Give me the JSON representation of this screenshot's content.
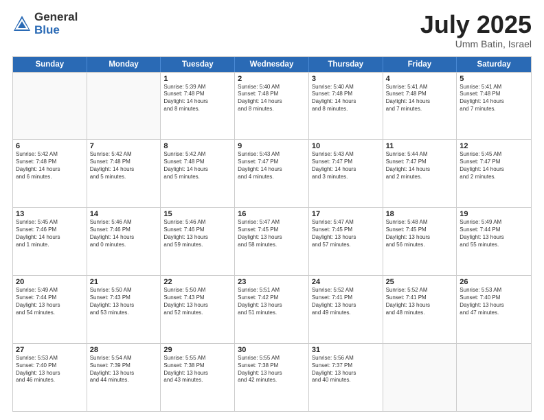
{
  "header": {
    "logo_general": "General",
    "logo_blue": "Blue",
    "month_title": "July 2025",
    "location": "Umm Batin, Israel"
  },
  "weekdays": [
    "Sunday",
    "Monday",
    "Tuesday",
    "Wednesday",
    "Thursday",
    "Friday",
    "Saturday"
  ],
  "rows": [
    [
      {
        "day": "",
        "info": ""
      },
      {
        "day": "",
        "info": ""
      },
      {
        "day": "1",
        "info": "Sunrise: 5:39 AM\nSunset: 7:48 PM\nDaylight: 14 hours\nand 8 minutes."
      },
      {
        "day": "2",
        "info": "Sunrise: 5:40 AM\nSunset: 7:48 PM\nDaylight: 14 hours\nand 8 minutes."
      },
      {
        "day": "3",
        "info": "Sunrise: 5:40 AM\nSunset: 7:48 PM\nDaylight: 14 hours\nand 8 minutes."
      },
      {
        "day": "4",
        "info": "Sunrise: 5:41 AM\nSunset: 7:48 PM\nDaylight: 14 hours\nand 7 minutes."
      },
      {
        "day": "5",
        "info": "Sunrise: 5:41 AM\nSunset: 7:48 PM\nDaylight: 14 hours\nand 7 minutes."
      }
    ],
    [
      {
        "day": "6",
        "info": "Sunrise: 5:42 AM\nSunset: 7:48 PM\nDaylight: 14 hours\nand 6 minutes."
      },
      {
        "day": "7",
        "info": "Sunrise: 5:42 AM\nSunset: 7:48 PM\nDaylight: 14 hours\nand 5 minutes."
      },
      {
        "day": "8",
        "info": "Sunrise: 5:42 AM\nSunset: 7:48 PM\nDaylight: 14 hours\nand 5 minutes."
      },
      {
        "day": "9",
        "info": "Sunrise: 5:43 AM\nSunset: 7:47 PM\nDaylight: 14 hours\nand 4 minutes."
      },
      {
        "day": "10",
        "info": "Sunrise: 5:43 AM\nSunset: 7:47 PM\nDaylight: 14 hours\nand 3 minutes."
      },
      {
        "day": "11",
        "info": "Sunrise: 5:44 AM\nSunset: 7:47 PM\nDaylight: 14 hours\nand 2 minutes."
      },
      {
        "day": "12",
        "info": "Sunrise: 5:45 AM\nSunset: 7:47 PM\nDaylight: 14 hours\nand 2 minutes."
      }
    ],
    [
      {
        "day": "13",
        "info": "Sunrise: 5:45 AM\nSunset: 7:46 PM\nDaylight: 14 hours\nand 1 minute."
      },
      {
        "day": "14",
        "info": "Sunrise: 5:46 AM\nSunset: 7:46 PM\nDaylight: 14 hours\nand 0 minutes."
      },
      {
        "day": "15",
        "info": "Sunrise: 5:46 AM\nSunset: 7:46 PM\nDaylight: 13 hours\nand 59 minutes."
      },
      {
        "day": "16",
        "info": "Sunrise: 5:47 AM\nSunset: 7:45 PM\nDaylight: 13 hours\nand 58 minutes."
      },
      {
        "day": "17",
        "info": "Sunrise: 5:47 AM\nSunset: 7:45 PM\nDaylight: 13 hours\nand 57 minutes."
      },
      {
        "day": "18",
        "info": "Sunrise: 5:48 AM\nSunset: 7:45 PM\nDaylight: 13 hours\nand 56 minutes."
      },
      {
        "day": "19",
        "info": "Sunrise: 5:49 AM\nSunset: 7:44 PM\nDaylight: 13 hours\nand 55 minutes."
      }
    ],
    [
      {
        "day": "20",
        "info": "Sunrise: 5:49 AM\nSunset: 7:44 PM\nDaylight: 13 hours\nand 54 minutes."
      },
      {
        "day": "21",
        "info": "Sunrise: 5:50 AM\nSunset: 7:43 PM\nDaylight: 13 hours\nand 53 minutes."
      },
      {
        "day": "22",
        "info": "Sunrise: 5:50 AM\nSunset: 7:43 PM\nDaylight: 13 hours\nand 52 minutes."
      },
      {
        "day": "23",
        "info": "Sunrise: 5:51 AM\nSunset: 7:42 PM\nDaylight: 13 hours\nand 51 minutes."
      },
      {
        "day": "24",
        "info": "Sunrise: 5:52 AM\nSunset: 7:41 PM\nDaylight: 13 hours\nand 49 minutes."
      },
      {
        "day": "25",
        "info": "Sunrise: 5:52 AM\nSunset: 7:41 PM\nDaylight: 13 hours\nand 48 minutes."
      },
      {
        "day": "26",
        "info": "Sunrise: 5:53 AM\nSunset: 7:40 PM\nDaylight: 13 hours\nand 47 minutes."
      }
    ],
    [
      {
        "day": "27",
        "info": "Sunrise: 5:53 AM\nSunset: 7:40 PM\nDaylight: 13 hours\nand 46 minutes."
      },
      {
        "day": "28",
        "info": "Sunrise: 5:54 AM\nSunset: 7:39 PM\nDaylight: 13 hours\nand 44 minutes."
      },
      {
        "day": "29",
        "info": "Sunrise: 5:55 AM\nSunset: 7:38 PM\nDaylight: 13 hours\nand 43 minutes."
      },
      {
        "day": "30",
        "info": "Sunrise: 5:55 AM\nSunset: 7:38 PM\nDaylight: 13 hours\nand 42 minutes."
      },
      {
        "day": "31",
        "info": "Sunrise: 5:56 AM\nSunset: 7:37 PM\nDaylight: 13 hours\nand 40 minutes."
      },
      {
        "day": "",
        "info": ""
      },
      {
        "day": "",
        "info": ""
      }
    ]
  ]
}
